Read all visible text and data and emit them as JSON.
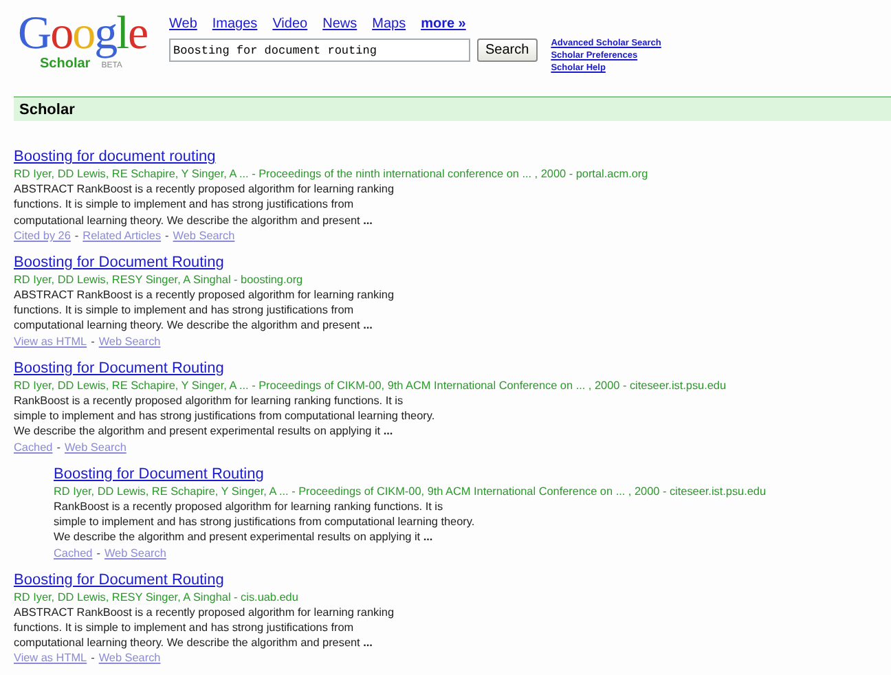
{
  "logo": {
    "word": "Google",
    "product": "Scholar",
    "badge": "BETA"
  },
  "nav": [
    {
      "label": "Web",
      "bold": false
    },
    {
      "label": "Images",
      "bold": false
    },
    {
      "label": "Video",
      "bold": false
    },
    {
      "label": "News",
      "bold": false
    },
    {
      "label": "Maps",
      "bold": false
    },
    {
      "label": "more »",
      "bold": true
    }
  ],
  "search": {
    "value": "Boosting for document routing",
    "button": "Search"
  },
  "side_links": [
    "Advanced Scholar Search",
    "Scholar Preferences",
    "Scholar Help"
  ],
  "section_bar": {
    "title": "Scholar"
  },
  "results": [
    {
      "title": "Boosting for document routing",
      "meta": "RD Iyer, DD Lewis, RE Schapire, Y Singer, A ... - Proceedings of the ninth international conference on ... , 2000 - portal.acm.org",
      "snippet": [
        "ABSTRACT RankBoost is a recently proposed algorithm for learning ranking",
        "functions. It is simple to implement and has strong justifications from",
        "computational learning theory. We describe the algorithm and present **...**"
      ],
      "links": [
        "Cited by 26",
        "Related Articles",
        "Web Search"
      ],
      "separator": "-"
    },
    {
      "title": "Boosting for Document Routing",
      "meta": "RD Iyer, DD Lewis, RESY Singer, A Singhal - boosting.org",
      "snippet": [
        "ABSTRACT RankBoost is a recently proposed algorithm for learning ranking",
        "functions. It is simple to implement and has strong justifications from",
        "computational learning theory. We describe the algorithm and present **...**"
      ],
      "links": [
        "View as HTML",
        "Web Search"
      ],
      "separator": "-"
    },
    {
      "title": "Boosting for Document Routing",
      "meta": "RD Iyer, DD Lewis, RE Schapire, Y Singer, A ... - Proceedings of CIKM-00, 9th ACM International Conference on ... , 2000 - citeseer.ist.psu.edu",
      "snippet": [
        "RankBoost is a recently proposed algorithm for learning ranking functions. It is",
        "simple to implement and has strong justifications from computational learning theory.",
        "We describe the algorithm and present experimental results on applying it **...**"
      ],
      "links": [
        "Cached",
        "Web Search"
      ],
      "separator": "-",
      "children": [
        {
          "title": "Boosting for Document Routing",
          "meta": "RD Iyer, DD Lewis, RE Schapire, Y Singer, A ... - Proceedings of CIKM-00, 9th ACM International Conference on ... , 2000 - citeseer.ist.psu.edu",
          "snippet": [
            "RankBoost is a recently proposed algorithm for learning ranking functions. It is",
            "simple to implement and has strong justifications from computational learning theory.",
            "We describe the algorithm and present experimental results on applying it **...**"
          ],
          "links": [
            "Cached",
            "Web Search"
          ],
          "separator": "-"
        }
      ]
    },
    {
      "title": "Boosting for Document Routing",
      "meta": "RD Iyer, DD Lewis, RESY Singer, A Singhal - cis.uab.edu",
      "snippet": [
        "ABSTRACT RankBoost is a recently proposed algorithm for learning ranking",
        "functions. It is simple to implement and has strong justifications from",
        "computational learning theory. We describe the algorithm and present **...**"
      ],
      "links": [
        "View as HTML",
        "Web Search"
      ],
      "separator": "-"
    }
  ]
}
